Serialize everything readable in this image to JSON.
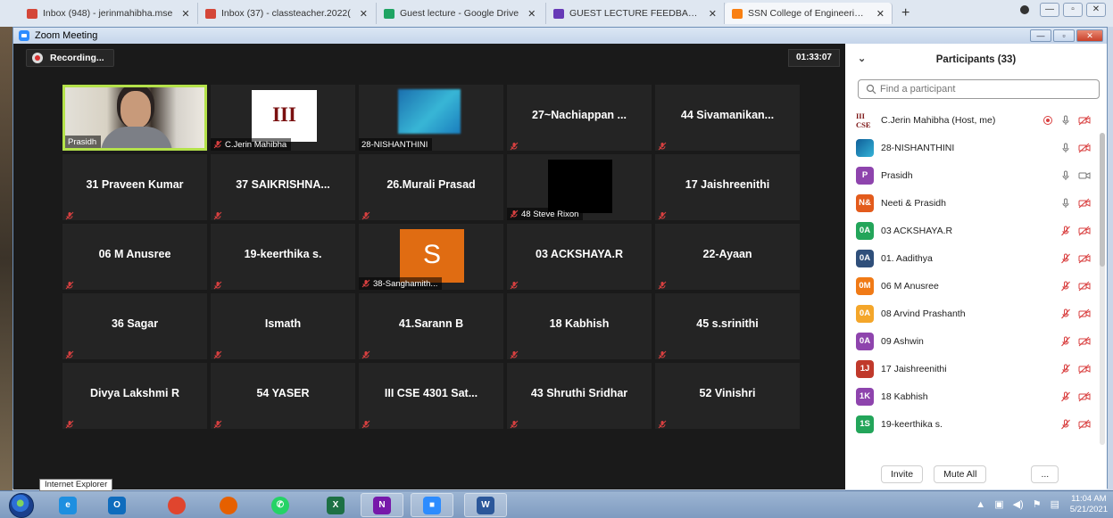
{
  "browser": {
    "tabs": [
      {
        "label": "Inbox (948) - jerinmahibha.mse",
        "icon": "gmail-icon",
        "color": "#d44638"
      },
      {
        "label": "Inbox (37) - classteacher.2022(",
        "icon": "gmail-icon",
        "color": "#d44638"
      },
      {
        "label": "Guest lecture - Google Drive",
        "icon": "google-drive-icon",
        "color": "#1fa463"
      },
      {
        "label": "GUEST LECTURE FEEDBACK FO",
        "icon": "google-forms-icon",
        "color": "#673ab7"
      },
      {
        "label": "SSN College of Engineering: Lo",
        "icon": "moodle-icon",
        "color": "#f98012",
        "active": true
      }
    ],
    "new_tab": "+"
  },
  "zoom": {
    "title": "Zoom Meeting",
    "recording_label": "Recording...",
    "timer": "01:33:07",
    "tiles": [
      {
        "name": "",
        "label": "Prasidh",
        "kind": "video",
        "muted": false
      },
      {
        "name": "",
        "label": "C.Jerin Mahibha",
        "kind": "cse",
        "image_text": "III CSE",
        "muted": true
      },
      {
        "name": "",
        "label": "28-NISHANTHINI",
        "kind": "blur",
        "muted": false
      },
      {
        "name": "27~Nachiappan ...",
        "label": "",
        "kind": "name",
        "muted": true
      },
      {
        "name": "44 Sivamanikan...",
        "label": "",
        "kind": "name",
        "muted": true
      },
      {
        "name": "31 Praveen Kumar",
        "label": "",
        "kind": "name",
        "muted": true
      },
      {
        "name": "37 SAIKRISHNA...",
        "label": "",
        "kind": "name",
        "muted": true
      },
      {
        "name": "26.Murali Prasad",
        "label": "",
        "kind": "name",
        "muted": true
      },
      {
        "name": "",
        "label": "48 Steve Rixon",
        "kind": "black",
        "muted": true
      },
      {
        "name": "17 Jaishreenithi",
        "label": "",
        "kind": "name",
        "muted": true
      },
      {
        "name": "06 M Anusree",
        "label": "",
        "kind": "name",
        "muted": true
      },
      {
        "name": "19-keerthika s.",
        "label": "",
        "kind": "name",
        "muted": true
      },
      {
        "name": "",
        "label": "38-Sanghamith...",
        "kind": "avatar",
        "avatar_letter": "S",
        "muted": true
      },
      {
        "name": "03 ACKSHAYA.R",
        "label": "",
        "kind": "name",
        "muted": true
      },
      {
        "name": "22-Ayaan",
        "label": "",
        "kind": "name",
        "muted": true
      },
      {
        "name": "36 Sagar",
        "label": "",
        "kind": "name",
        "muted": true
      },
      {
        "name": "Ismath",
        "label": "",
        "kind": "name",
        "muted": true
      },
      {
        "name": "41.Sarann B",
        "label": "",
        "kind": "name",
        "muted": true
      },
      {
        "name": "18 Kabhish",
        "label": "",
        "kind": "name",
        "muted": true
      },
      {
        "name": "45 s.srinithi",
        "label": "",
        "kind": "name",
        "muted": true
      },
      {
        "name": "Divya Lakshmi R",
        "label": "",
        "kind": "name",
        "muted": true
      },
      {
        "name": "54 YASER",
        "label": "",
        "kind": "name",
        "muted": true
      },
      {
        "name": "III CSE 4301 Sat...",
        "label": "",
        "kind": "name",
        "muted": true
      },
      {
        "name": "43 Shruthi Sridhar",
        "label": "",
        "kind": "name",
        "muted": true
      },
      {
        "name": "52 Vinishri",
        "label": "",
        "kind": "name",
        "muted": true
      }
    ]
  },
  "panel": {
    "title": "Participants (33)",
    "search_placeholder": "Find a participant",
    "participants": [
      {
        "initials": "III CSE",
        "name": "C.Jerin Mahibha (Host, me)",
        "color": "#ffffff",
        "avatar": "cse",
        "mic": "unmuted",
        "recording": true,
        "video": "off"
      },
      {
        "initials": "",
        "name": "28-NISHANTHINI",
        "color": "#1a7dbd",
        "avatar": "img",
        "mic": "unmuted",
        "video": "off"
      },
      {
        "initials": "P",
        "name": "Prasidh",
        "color": "#8e44ad",
        "avatar": "letter",
        "mic": "unmuted",
        "video": "on"
      },
      {
        "initials": "N&",
        "name": "Neeti & Prasidh",
        "color": "#e35b1c",
        "avatar": "letter",
        "mic": "unmuted",
        "video": "off"
      },
      {
        "initials": "0A",
        "name": "03 ACKSHAYA.R",
        "color": "#23a55a",
        "avatar": "letter",
        "mic": "muted",
        "video": "off"
      },
      {
        "initials": "0A",
        "name": "01. Aadithya",
        "color": "#2f4f7a",
        "avatar": "letter",
        "mic": "muted",
        "video": "off"
      },
      {
        "initials": "0M",
        "name": "06 M Anusree",
        "color": "#f07a16",
        "avatar": "letter",
        "mic": "muted",
        "video": "off"
      },
      {
        "initials": "0A",
        "name": "08 Arvind Prashanth",
        "color": "#f4a62a",
        "avatar": "letter",
        "mic": "muted",
        "video": "off"
      },
      {
        "initials": "0A",
        "name": "09 Ashwin",
        "color": "#8e44ad",
        "avatar": "letter",
        "mic": "muted",
        "video": "off"
      },
      {
        "initials": "1J",
        "name": "17 Jaishreenithi",
        "color": "#c0392b",
        "avatar": "letter",
        "mic": "muted",
        "video": "off"
      },
      {
        "initials": "1K",
        "name": "18 Kabhish",
        "color": "#8e44ad",
        "avatar": "letter",
        "mic": "muted",
        "video": "off"
      },
      {
        "initials": "1S",
        "name": "19-keerthika s.",
        "color": "#23a55a",
        "avatar": "letter",
        "mic": "muted",
        "video": "off"
      }
    ],
    "invite_label": "Invite",
    "mute_all_label": "Mute All",
    "more_label": "..."
  },
  "taskbar": {
    "tooltip": "Internet Explorer",
    "apps": [
      {
        "name": "ie-icon",
        "color": "#1e8fe0",
        "glyph": "e"
      },
      {
        "name": "outlook-icon",
        "color": "#0f6cbd",
        "glyph": "O"
      },
      {
        "name": "chrome-icon",
        "color": "#e0452e",
        "glyph": ""
      },
      {
        "name": "firefox-icon",
        "color": "#e66000",
        "glyph": ""
      },
      {
        "name": "whatsapp-icon",
        "color": "#25d366",
        "glyph": "✆"
      },
      {
        "name": "excel-icon",
        "color": "#1d7044",
        "glyph": "X"
      },
      {
        "name": "onenote-icon",
        "color": "#7719aa",
        "glyph": "N"
      },
      {
        "name": "zoom-icon",
        "color": "#2d8cff",
        "glyph": "■"
      },
      {
        "name": "word-icon",
        "color": "#2b579a",
        "glyph": "W"
      }
    ],
    "time": "11:04 AM",
    "date": "5/21/2021"
  }
}
